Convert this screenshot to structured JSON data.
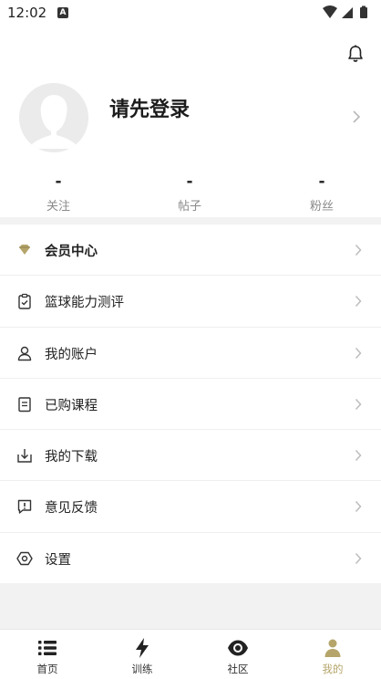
{
  "status_bar": {
    "time": "12:02",
    "notification_letter": "A"
  },
  "profile": {
    "login_prompt": "请先登录"
  },
  "stats": [
    {
      "value": "-",
      "label": "关注"
    },
    {
      "value": "-",
      "label": "帖子"
    },
    {
      "value": "-",
      "label": "粉丝"
    }
  ],
  "menu": {
    "items": [
      {
        "label": "会员中心",
        "icon": "diamond-icon"
      },
      {
        "label": "篮球能力测评",
        "icon": "clipboard-check-icon"
      },
      {
        "label": "我的账户",
        "icon": "user-icon"
      },
      {
        "label": "已购课程",
        "icon": "document-icon"
      },
      {
        "label": "我的下载",
        "icon": "download-icon"
      },
      {
        "label": "意见反馈",
        "icon": "feedback-icon"
      },
      {
        "label": "设置",
        "icon": "settings-icon"
      }
    ]
  },
  "tabbar": {
    "tabs": [
      {
        "label": "首页",
        "icon": "list-icon"
      },
      {
        "label": "训练",
        "icon": "lightning-icon"
      },
      {
        "label": "社区",
        "icon": "eye-icon"
      },
      {
        "label": "我的",
        "icon": "person-icon"
      }
    ],
    "active_index": 3
  },
  "colors": {
    "accent": "#b5a56a",
    "text": "#222222",
    "muted": "#8a8a8a",
    "band": "#f2f2f2"
  }
}
